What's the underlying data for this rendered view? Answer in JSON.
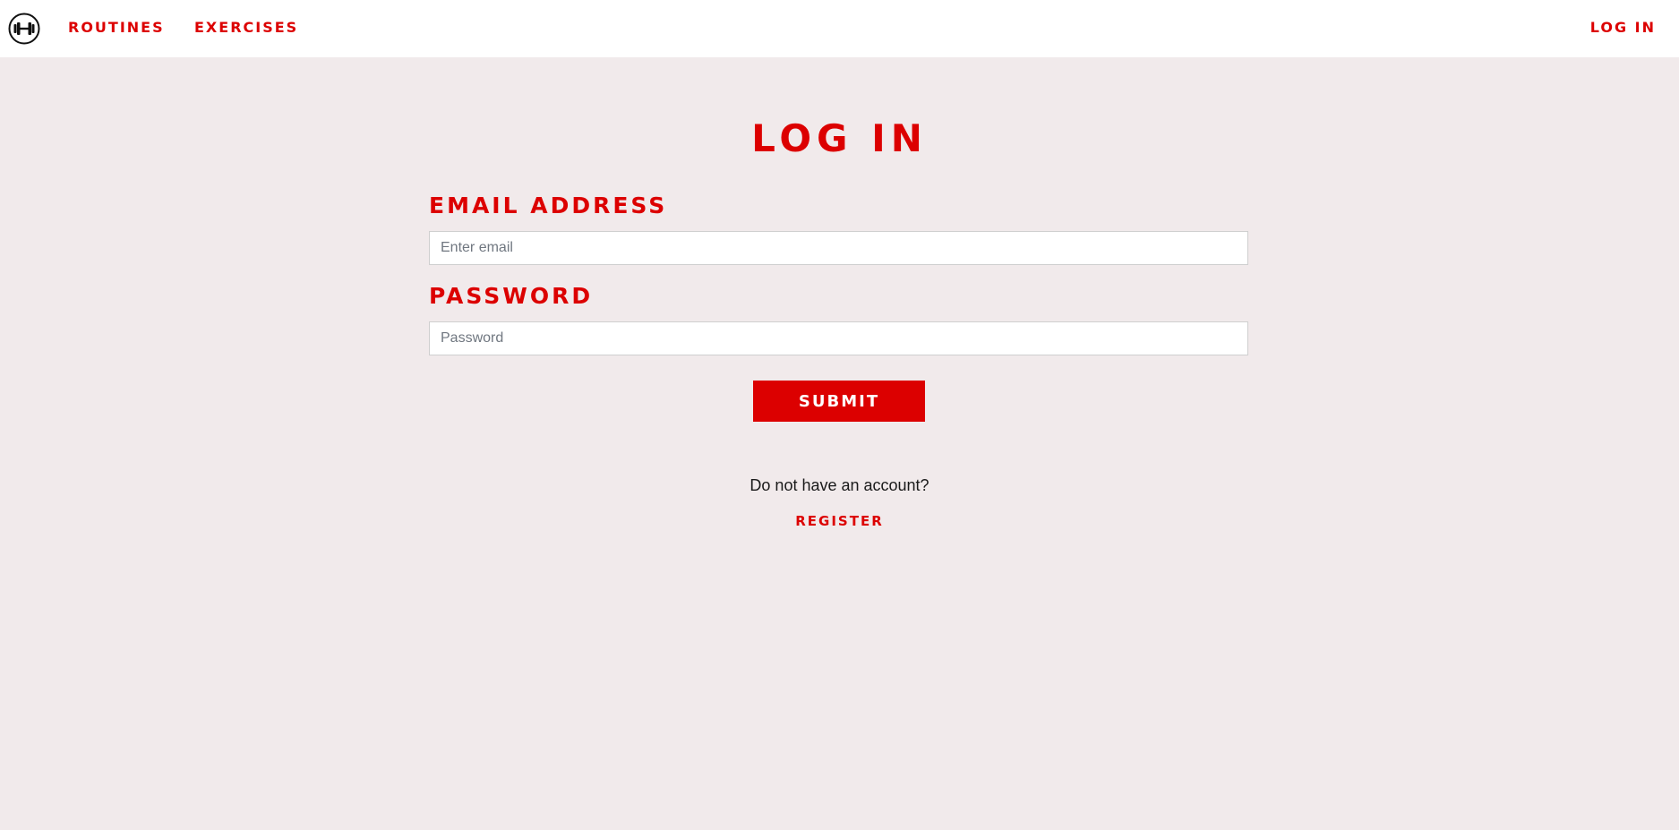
{
  "nav": {
    "logo_icon": "dumbbell-icon",
    "routines_label": "ROUTINES",
    "exercises_label": "EXERCISES",
    "login_label": "LOG IN"
  },
  "login_form": {
    "title": "LOG IN",
    "email_label": "EMAIL ADDRESS",
    "email_placeholder": "Enter email",
    "email_value": "",
    "password_label": "PASSWORD",
    "password_placeholder": "Password",
    "password_value": "",
    "submit_label": "SUBMIT"
  },
  "register_prompt": {
    "text": "Do not have an account?",
    "link_label": "REGISTER"
  },
  "colors": {
    "accent": "#dc0000",
    "background": "#f1eaeb",
    "navbar": "#ffffff"
  }
}
